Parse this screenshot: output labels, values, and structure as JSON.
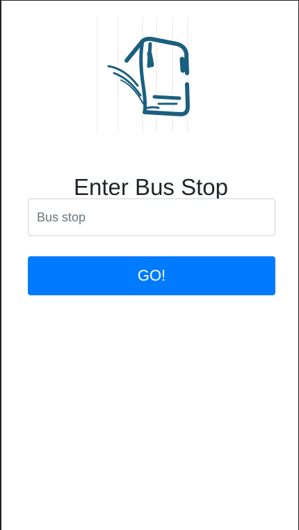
{
  "logo": {
    "icon": "bus-icon",
    "color": "#1b5f80"
  },
  "heading": "Enter Bus Stop",
  "search": {
    "placeholder": "Bus stop",
    "value": ""
  },
  "button": {
    "label": "GO!",
    "color": "#007bff"
  }
}
